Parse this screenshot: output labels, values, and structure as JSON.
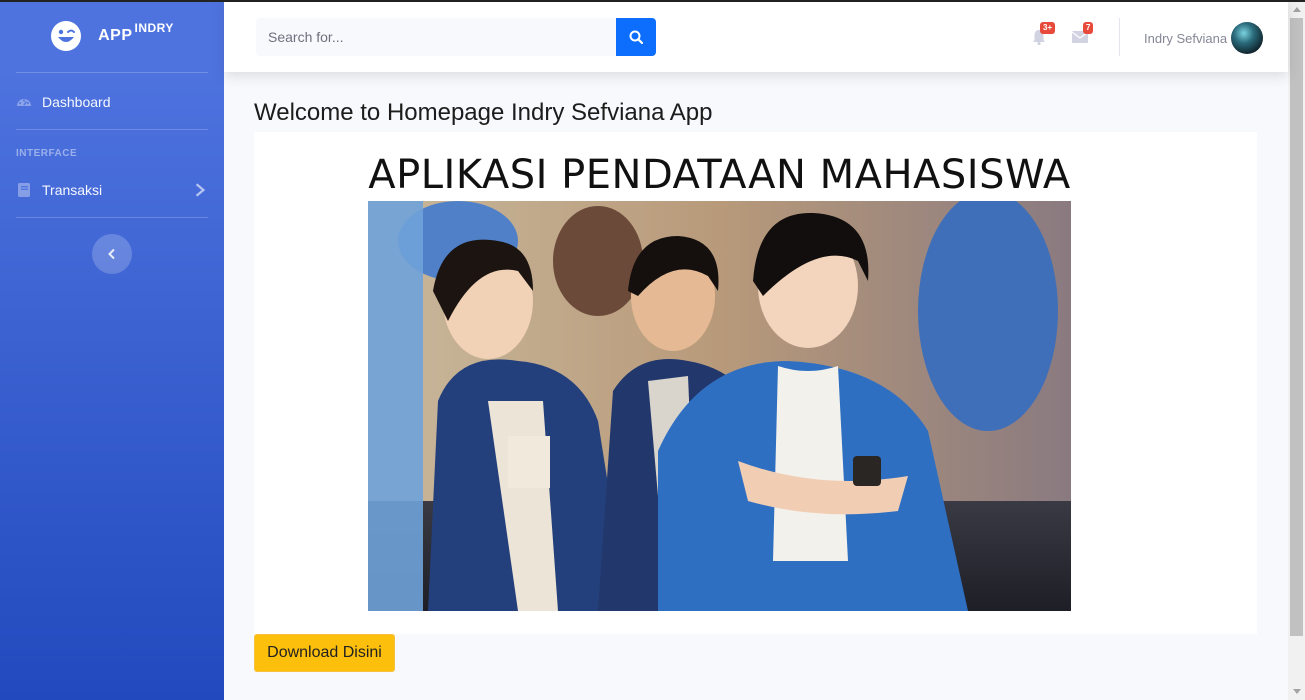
{
  "sidebar": {
    "brand_main": "APP",
    "brand_sup": "INDRY",
    "nav_dashboard": "Dashboard",
    "heading_interface": "INTERFACE",
    "nav_transaksi": "Transaksi"
  },
  "topbar": {
    "search_placeholder": "Search for...",
    "alerts_badge": "3+",
    "messages_badge": "7",
    "user_name": "Indry Sefviana"
  },
  "main": {
    "page_title": "Welcome to Homepage Indry Sefviana App",
    "poster_title": "APLIKASI PENDATAAN MAHASISWA",
    "download_label": "Download Disini"
  },
  "colors": {
    "sidebar_gradient_top": "#4e73df",
    "sidebar_gradient_bottom": "#224abe",
    "search_button": "#0d6efd",
    "badge": "#e74a3b",
    "download_button": "#fbbf0c"
  },
  "icons": {
    "brand": "laugh-wink-icon",
    "dashboard": "tachometer-icon",
    "transaksi": "book-icon",
    "search": "search-icon",
    "alerts": "bell-icon",
    "messages": "envelope-icon",
    "sidebar_toggle": "chevron-left-icon"
  }
}
